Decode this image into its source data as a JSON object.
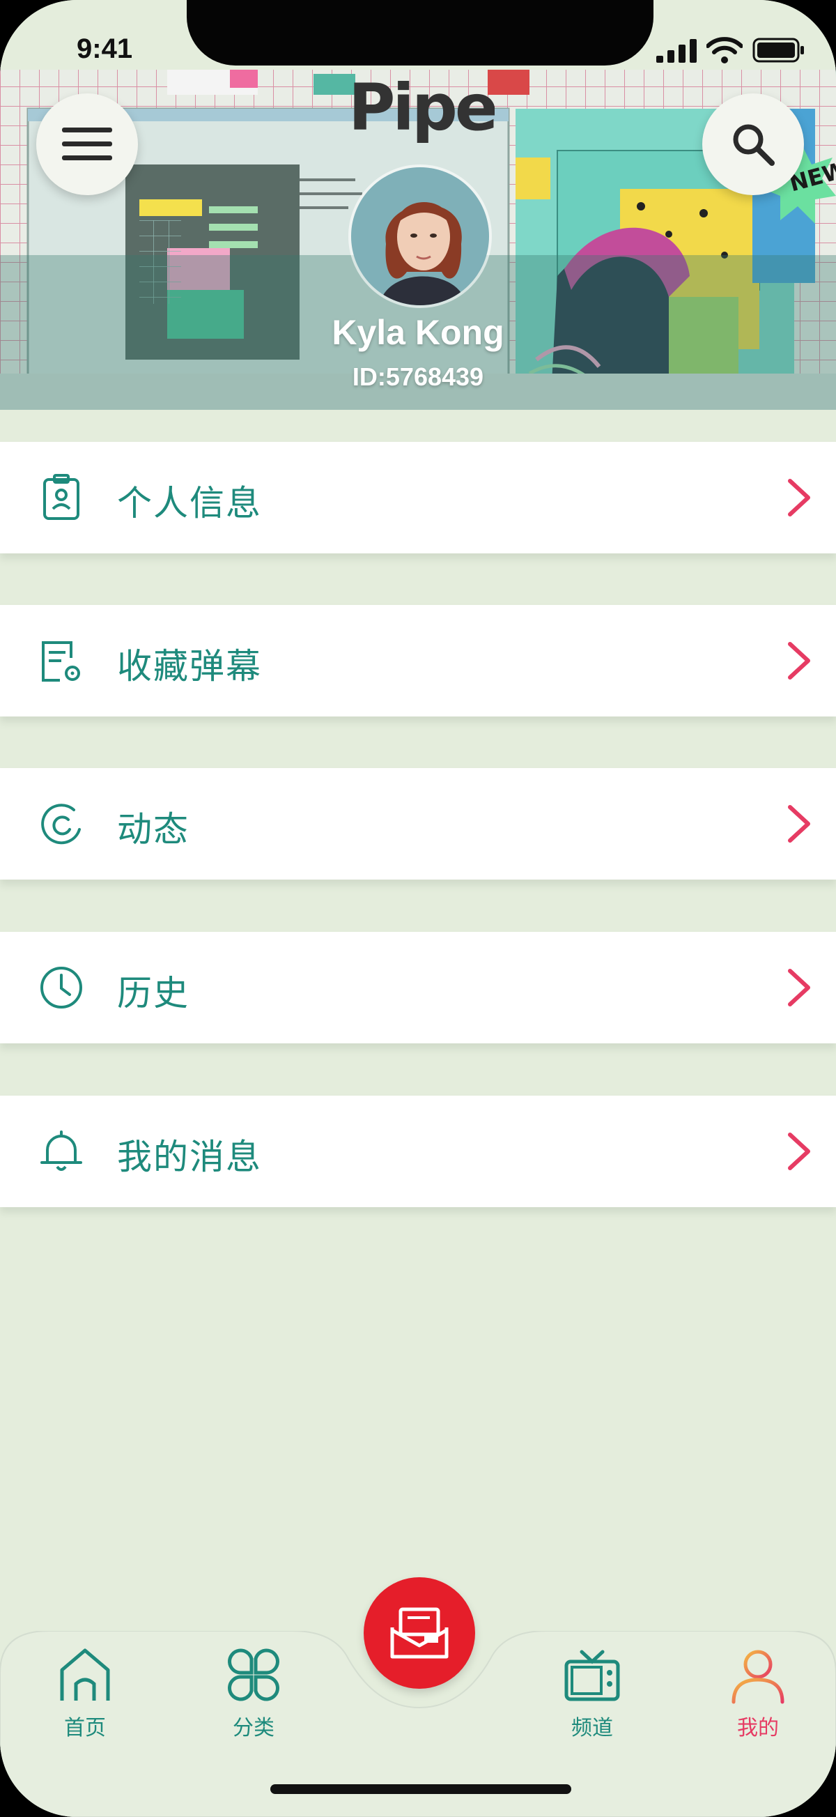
{
  "status_bar": {
    "time": "9:41"
  },
  "header": {
    "logo_text": "Pipe",
    "user_name": "Kyla Kong",
    "user_id": "ID:5768439",
    "menu_icon": "hamburger-icon",
    "search_icon": "search-icon"
  },
  "menu": {
    "items": [
      {
        "label": "个人信息",
        "icon": "id-badge-icon"
      },
      {
        "label": "收藏弹幕",
        "icon": "document-gear-icon"
      },
      {
        "label": "动态",
        "icon": "activity-icon"
      },
      {
        "label": "历史",
        "icon": "clock-icon"
      },
      {
        "label": "我的消息",
        "icon": "bell-icon"
      }
    ]
  },
  "tab_bar": {
    "tabs": [
      {
        "label": "首页",
        "icon": "home-icon",
        "active": false
      },
      {
        "label": "分类",
        "icon": "category-icon",
        "active": false
      },
      {
        "label": "频道",
        "icon": "tv-icon",
        "active": false
      },
      {
        "label": "我的",
        "icon": "profile-icon",
        "active": true
      }
    ],
    "center_button_icon": "mail-icon"
  },
  "colors": {
    "background": "#e4eddc",
    "accent_teal": "#1e8a7c",
    "arrow_pink": "#e63b63",
    "center_button_red": "#e51e2a"
  }
}
